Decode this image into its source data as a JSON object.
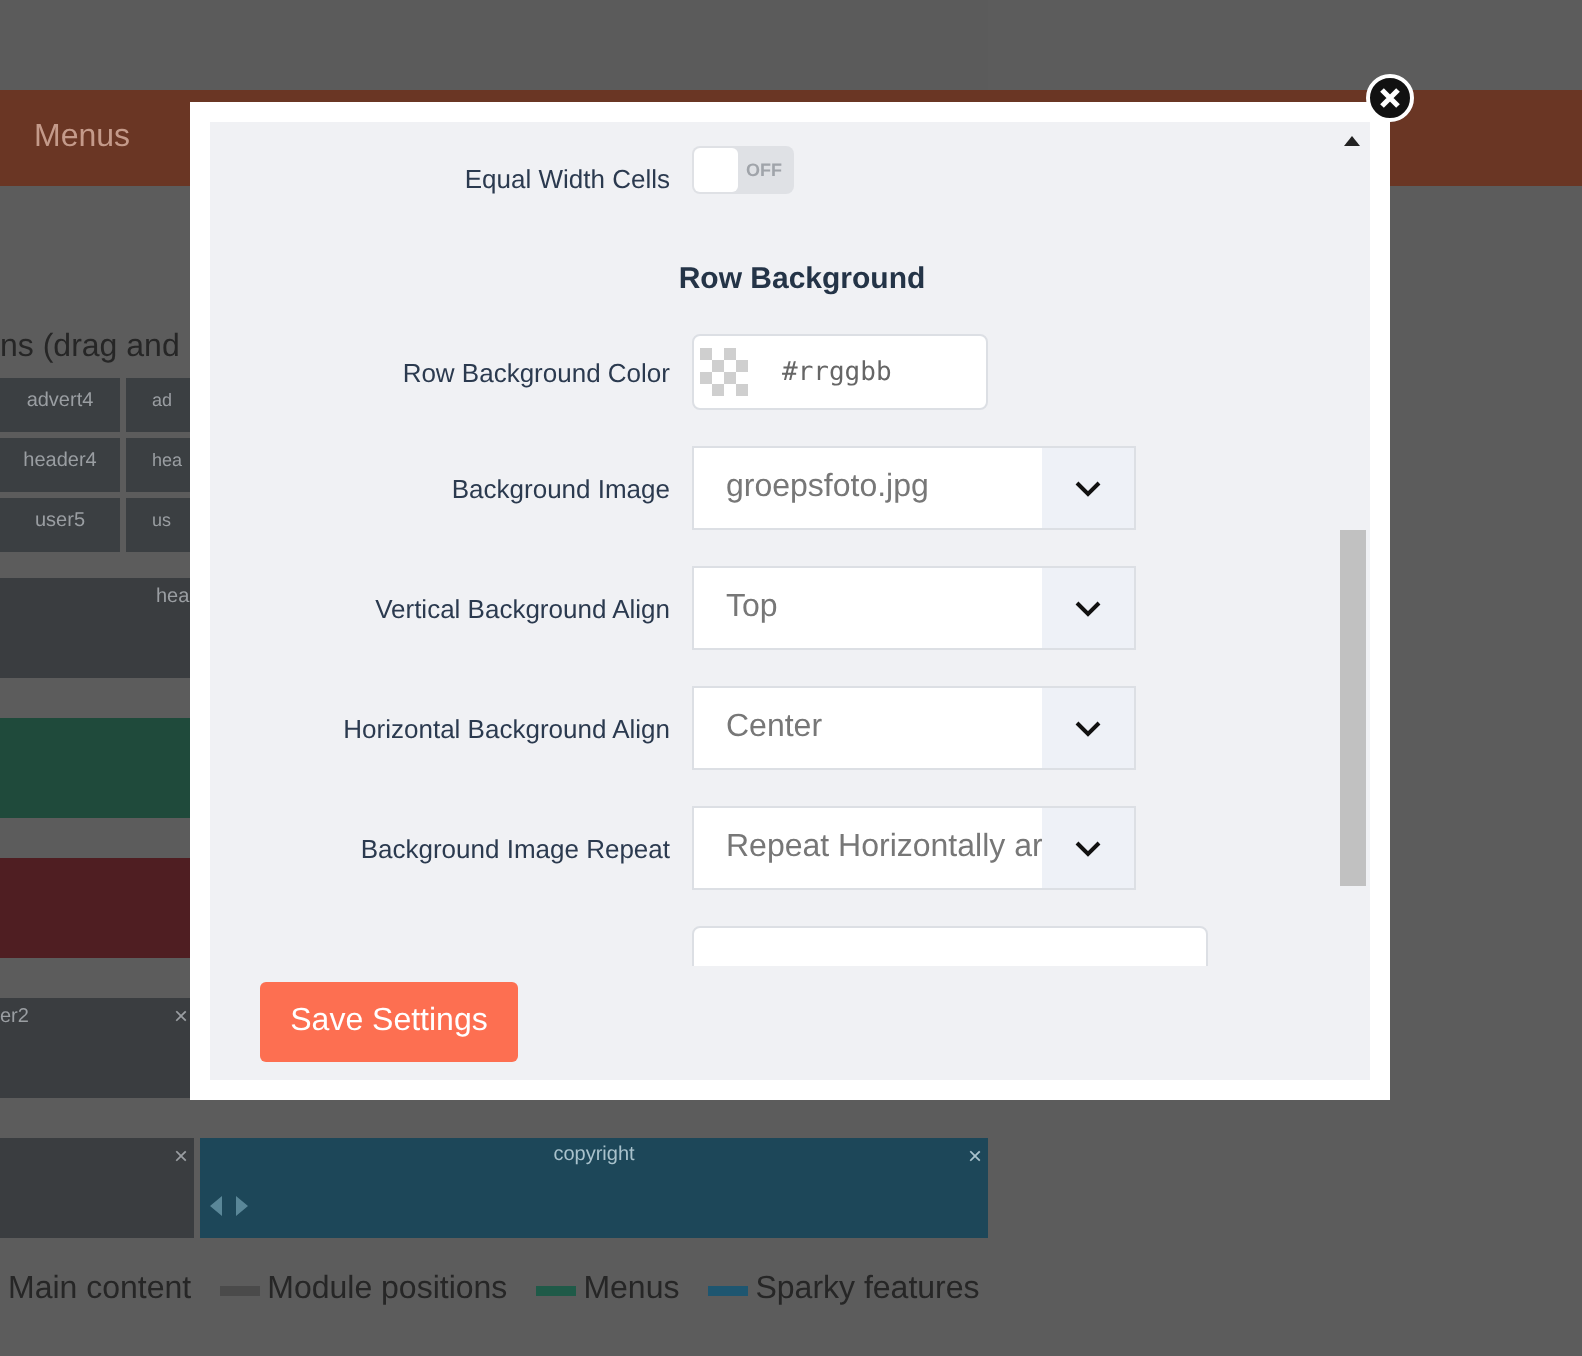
{
  "page": {
    "nav": {
      "label": "Menus"
    },
    "heading": "ns (drag and",
    "grid": [
      [
        "advert4",
        "ad"
      ],
      [
        "header4",
        "hea"
      ],
      [
        "user5",
        "us"
      ]
    ],
    "blocks": [
      {
        "kind": "header",
        "color": "#3a3d40",
        "label": "hea"
      },
      {
        "kind": "plain",
        "color": "#1f4a3b"
      },
      {
        "kind": "plain",
        "color": "#4f1e22"
      },
      {
        "kind": "position",
        "color": "#3a3d40",
        "label": "er2",
        "close": "×"
      }
    ],
    "footer_row": [
      {
        "kind": "position",
        "color": "#3a3d40",
        "close": "×"
      },
      {
        "kind": "feature",
        "color": "#1d4759",
        "label": "copyright",
        "close": "×"
      }
    ],
    "legend": [
      {
        "label": "Main content"
      },
      {
        "label": "Module positions",
        "color": "#4a4a4a"
      },
      {
        "label": "Menus",
        "color": "#1f5a48"
      },
      {
        "label": "Sparky features",
        "color": "#1e5670"
      }
    ]
  },
  "modal": {
    "rows": [
      {
        "kind": "toggle",
        "label": "Equal Width Cells",
        "on": false,
        "state_text": "OFF"
      },
      {
        "kind": "heading",
        "label": "Row Background"
      },
      {
        "kind": "color",
        "label": "Row Background Color",
        "placeholder": "#rrggbb"
      },
      {
        "kind": "select",
        "label": "Background Image",
        "value": "groepsfoto.jpg"
      },
      {
        "kind": "select",
        "label": "Vertical Background Align",
        "value": "Top"
      },
      {
        "kind": "select",
        "label": "Horizontal Background Align",
        "value": "Center"
      },
      {
        "kind": "select",
        "label": "Background Image Repeat",
        "value": "Repeat Horizontally ar"
      },
      {
        "kind": "text"
      }
    ],
    "button": "Save Settings"
  }
}
